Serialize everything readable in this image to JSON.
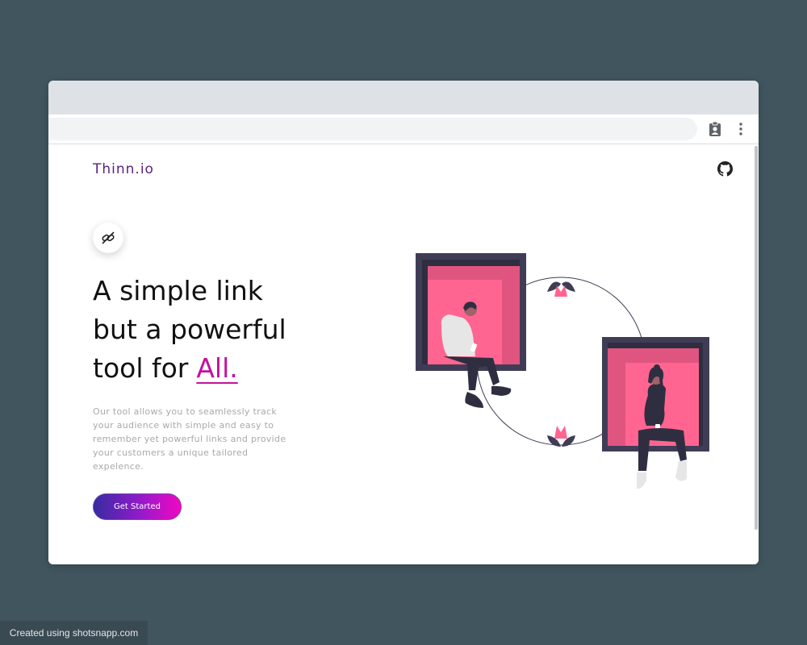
{
  "site": {
    "brand": "Thinn.io",
    "headline": {
      "line1": "A simple link",
      "line2": "but a powerful",
      "line3": "tool for",
      "accent": "All."
    },
    "description": "Our tool allows you to seamlessly track your audience with simple and easy to remember yet powerful links and provide your customers a unique tailored expelence.",
    "cta_label": "Get Started"
  },
  "icons": {
    "browser_extension": "clipboard-user-icon",
    "browser_menu": "kebab-menu-icon",
    "github": "github-icon",
    "link": "link-icon"
  },
  "colors": {
    "background": "#41555f",
    "brand": "#5a1f86",
    "accent": "#c3129d",
    "cta_start": "#372ba0",
    "cta_end": "#f207c4",
    "illustration_pink": "#ff6590",
    "illustration_dark": "#3f3d56"
  },
  "watermark": "Created using shotsnapp.com"
}
